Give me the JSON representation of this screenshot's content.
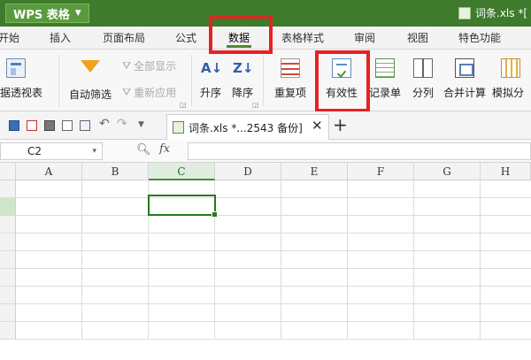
{
  "app": {
    "name": "WPS 表格",
    "window_file": "词条.xls *[",
    "accent": "#3e7b2c"
  },
  "menu": {
    "tabs": [
      "开始",
      "插入",
      "页面布局",
      "公式",
      "数据",
      "表格样式",
      "审阅",
      "视图",
      "特色功能"
    ],
    "active": "数据"
  },
  "ribbon": {
    "pivot": "数据透视表",
    "autofilter": "自动筛选",
    "show_all": "全部显示",
    "reapply": "重新应用",
    "sort_asc": "升序",
    "sort_desc": "降序",
    "duplicates": "重复项",
    "validity": "有效性",
    "record": "记录单",
    "split": "分列",
    "consolidate": "合并计算",
    "simulate": "模拟分"
  },
  "document_tab": {
    "title": "词条.xls *...2543 备份]"
  },
  "formula_bar": {
    "cell_ref": "C2",
    "fx": "fx",
    "value": ""
  },
  "sheet": {
    "columns": [
      "A",
      "B",
      "C",
      "D",
      "E",
      "F",
      "G",
      "H"
    ],
    "active_column": "C",
    "active_row": 2
  },
  "colors": {
    "highlight_box": "#e52222",
    "selection": "#247a1a"
  }
}
